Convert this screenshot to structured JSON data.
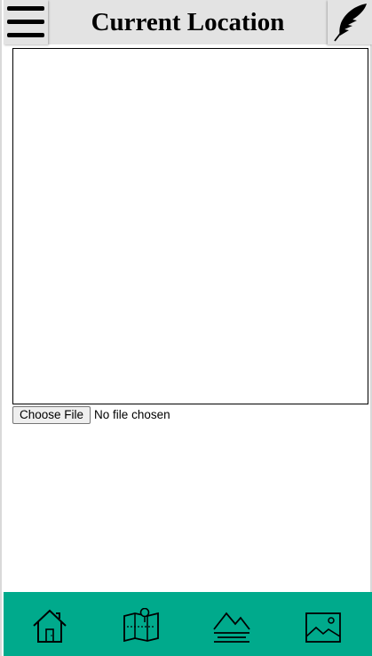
{
  "header": {
    "title": "Current Location",
    "menu_icon": "hamburger-menu-icon",
    "right_icon": "feather-icon"
  },
  "file_input": {
    "button_label": "Choose File",
    "status_text": "No file chosen"
  },
  "bottom_nav": {
    "background": "#00aa8c",
    "items": [
      {
        "icon": "home-icon"
      },
      {
        "icon": "map-icon"
      },
      {
        "icon": "mountains-icon"
      },
      {
        "icon": "image-icon"
      }
    ]
  }
}
